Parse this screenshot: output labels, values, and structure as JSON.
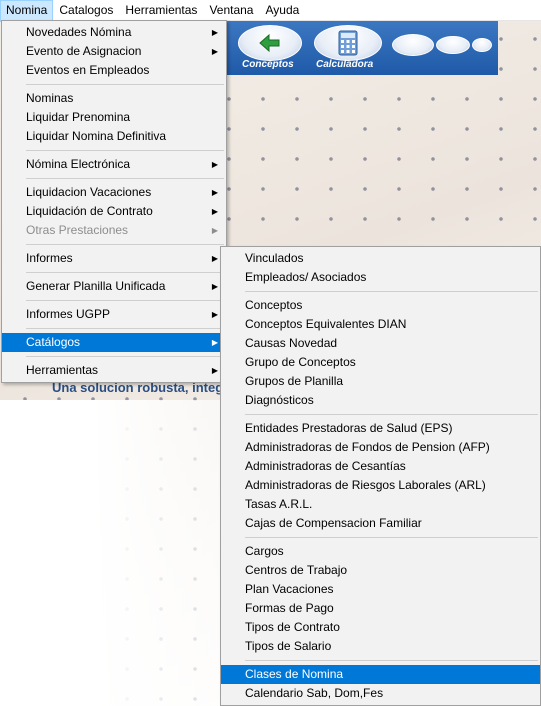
{
  "menubar": [
    "Nomina",
    "Catalogos",
    "Herramientas",
    "Ventana",
    "Ayuda"
  ],
  "toolbar": {
    "conceptos": "Conceptos",
    "calculadora": "Calculadora"
  },
  "background": {
    "tagline": "Una solucion robusta, integral"
  },
  "nomina_menu": [
    {
      "label": "Novedades Nómina",
      "submenu": true
    },
    {
      "label": "Evento de Asignacion",
      "submenu": true
    },
    {
      "label": "Eventos en Empleados"
    },
    {
      "sep": true
    },
    {
      "label": "Nominas"
    },
    {
      "label": "Liquidar Prenomina"
    },
    {
      "label": "Liquidar Nomina Definitiva"
    },
    {
      "sep": true
    },
    {
      "label": "Nómina Electrónica",
      "submenu": true
    },
    {
      "sep": true
    },
    {
      "label": "Liquidacion Vacaciones",
      "submenu": true
    },
    {
      "label": "Liquidación de Contrato",
      "submenu": true
    },
    {
      "label": "Otras Prestaciones",
      "submenu": true,
      "disabled": true
    },
    {
      "sep": true
    },
    {
      "label": "Informes",
      "submenu": true
    },
    {
      "sep": true
    },
    {
      "label": "Generar Planilla Unificada",
      "submenu": true
    },
    {
      "sep": true
    },
    {
      "label": "Informes UGPP",
      "submenu": true
    },
    {
      "sep": true
    },
    {
      "label": "Catálogos",
      "submenu": true,
      "selected": true
    },
    {
      "sep": true
    },
    {
      "label": "Herramientas",
      "submenu": true
    }
  ],
  "catalogos_menu": [
    {
      "label": "Vinculados"
    },
    {
      "label": "Empleados/ Asociados"
    },
    {
      "sep": true
    },
    {
      "label": "Conceptos"
    },
    {
      "label": "Conceptos Equivalentes DIAN"
    },
    {
      "label": "Causas Novedad"
    },
    {
      "label": "Grupo de Conceptos"
    },
    {
      "label": "Grupos de Planilla"
    },
    {
      "label": "Diagnósticos"
    },
    {
      "sep": true
    },
    {
      "label": "Entidades Prestadoras de Salud (EPS)"
    },
    {
      "label": "Administradoras de Fondos de Pension (AFP)"
    },
    {
      "label": "Administradoras de Cesantías"
    },
    {
      "label": "Administradoras de Riesgos Laborales (ARL)"
    },
    {
      "label": "Tasas A.R.L."
    },
    {
      "label": "Cajas de Compensacion Familiar"
    },
    {
      "sep": true
    },
    {
      "label": "Cargos"
    },
    {
      "label": "Centros de Trabajo"
    },
    {
      "label": "Plan Vacaciones"
    },
    {
      "label": "Formas de Pago"
    },
    {
      "label": "Tipos de Contrato"
    },
    {
      "label": "Tipos de Salario"
    },
    {
      "sep": true
    },
    {
      "label": "Clases de Nomina",
      "selected": true
    },
    {
      "label": "Calendario Sab, Dom,Fes"
    }
  ]
}
